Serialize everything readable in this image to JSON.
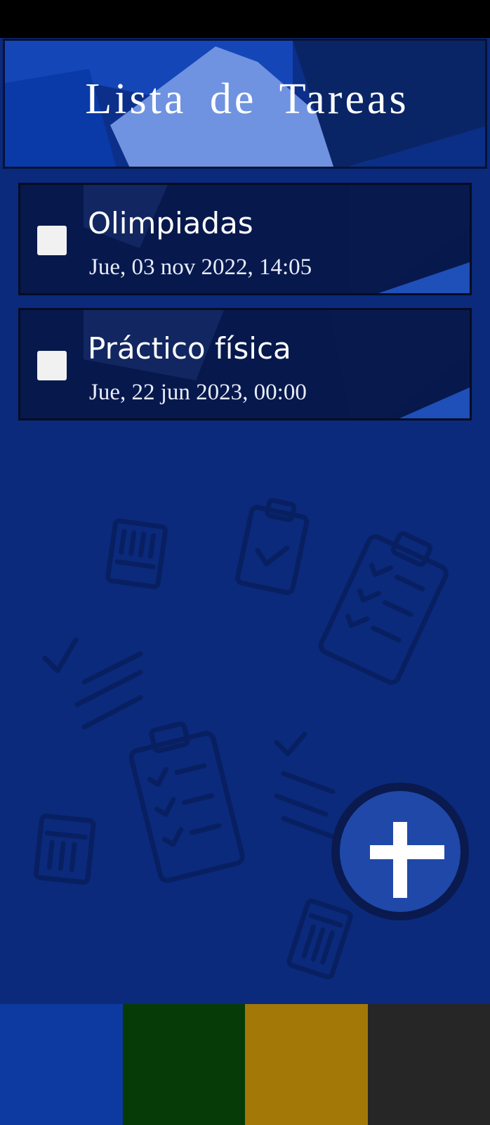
{
  "header": {
    "title": "Lista de Tareas"
  },
  "tasks": [
    {
      "title": "Olimpiadas",
      "date": "Jue, 03 nov 2022, 14:05",
      "checked": false
    },
    {
      "title": "Práctico física",
      "date": "Jue, 22 jun 2023, 00:00",
      "checked": false
    }
  ],
  "fab": {
    "icon": "plus-icon"
  },
  "theme_swatches": [
    {
      "name": "blue",
      "color": "#0d3aa0"
    },
    {
      "name": "green",
      "color": "#063b08"
    },
    {
      "name": "gold",
      "color": "#a37807"
    },
    {
      "name": "dark-gray",
      "color": "#262626"
    }
  ],
  "colors": {
    "background": "#0b2a7c",
    "header_accent": "#6f93e0",
    "card_background": "#06123a",
    "fab": "#1f48a8"
  }
}
